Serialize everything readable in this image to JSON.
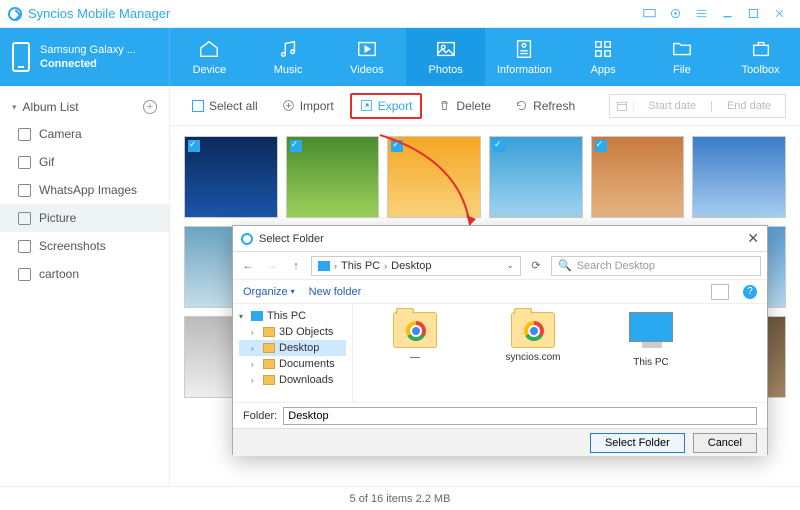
{
  "app": {
    "title": "Syncios Mobile Manager"
  },
  "device": {
    "name": "Samsung Galaxy ...",
    "status": "Connected"
  },
  "nav": {
    "items": [
      {
        "label": "Device"
      },
      {
        "label": "Music"
      },
      {
        "label": "Videos"
      },
      {
        "label": "Photos",
        "active": true
      },
      {
        "label": "Information"
      },
      {
        "label": "Apps"
      },
      {
        "label": "File"
      },
      {
        "label": "Toolbox"
      }
    ]
  },
  "sidebar": {
    "header": "Album List",
    "items": [
      {
        "label": "Camera"
      },
      {
        "label": "Gif"
      },
      {
        "label": "WhatsApp Images"
      },
      {
        "label": "Picture",
        "active": true
      },
      {
        "label": "Screenshots"
      },
      {
        "label": "cartoon"
      }
    ]
  },
  "toolbar": {
    "select_all": "Select all",
    "import": "Import",
    "export": "Export",
    "delete": "Delete",
    "refresh": "Refresh",
    "start_date": "Start date",
    "end_date": "End date"
  },
  "status": {
    "text": "5 of 16 items 2.2 MB"
  },
  "dialog": {
    "title": "Select Folder",
    "breadcrumb": {
      "root": "This PC",
      "current": "Desktop"
    },
    "search_placeholder": "Search Desktop",
    "organize": "Organize",
    "new_folder": "New folder",
    "tree": [
      {
        "label": "This PC",
        "type": "pc",
        "expanded": true
      },
      {
        "label": "3D Objects",
        "type": "folder"
      },
      {
        "label": "Desktop",
        "type": "folder",
        "selected": true
      },
      {
        "label": "Documents",
        "type": "folder"
      },
      {
        "label": "Downloads",
        "type": "folder"
      }
    ],
    "files": [
      {
        "label": "—",
        "type": "chrome-folder"
      },
      {
        "label": "syncios.com",
        "type": "chrome-folder"
      },
      {
        "label": "This PC",
        "type": "pc"
      }
    ],
    "folder_label": "Folder:",
    "folder_value": "Desktop",
    "select_btn": "Select Folder",
    "cancel_btn": "Cancel"
  }
}
